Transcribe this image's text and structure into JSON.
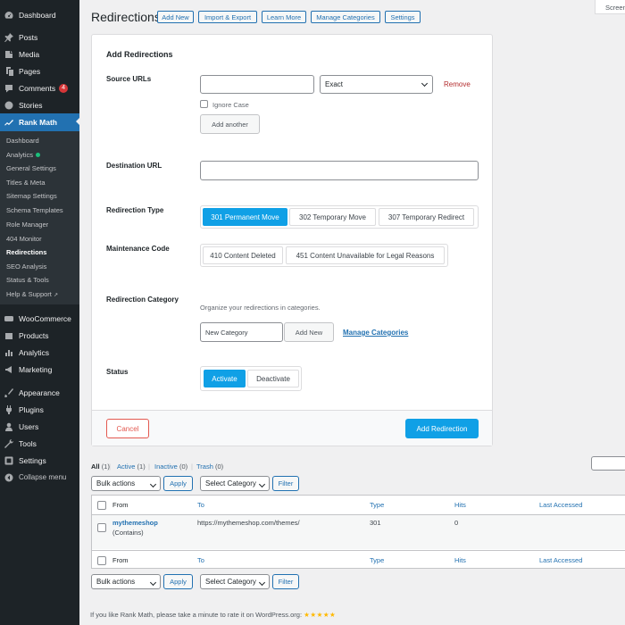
{
  "sidebar": {
    "top_items": [
      {
        "label": "Dashboard",
        "icon": "dashboard-icon"
      },
      {
        "label": "Posts",
        "icon": "pin-icon"
      },
      {
        "label": "Media",
        "icon": "media-icon"
      },
      {
        "label": "Pages",
        "icon": "pages-icon"
      },
      {
        "label": "Comments",
        "icon": "comment-icon",
        "badge": "4"
      },
      {
        "label": "Stories",
        "icon": "stories-icon"
      },
      {
        "label": "Rank Math",
        "icon": "rank-math-icon"
      }
    ],
    "submenu": [
      "Dashboard",
      "Analytics",
      "General Settings",
      "Titles & Meta",
      "Sitemap Settings",
      "Schema Templates",
      "Role Manager",
      "404 Monitor",
      "Redirections",
      "SEO Analysis",
      "Status & Tools",
      "Help & Support"
    ],
    "bottom_items": [
      {
        "label": "WooCommerce",
        "icon": "woocommerce-icon"
      },
      {
        "label": "Products",
        "icon": "products-icon"
      },
      {
        "label": "Analytics",
        "icon": "analytics-icon"
      },
      {
        "label": "Marketing",
        "icon": "marketing-icon"
      },
      {
        "label": "Appearance",
        "icon": "appearance-icon"
      },
      {
        "label": "Plugins",
        "icon": "plugins-icon"
      },
      {
        "label": "Users",
        "icon": "users-icon"
      },
      {
        "label": "Tools",
        "icon": "tools-icon"
      },
      {
        "label": "Settings",
        "icon": "settings-icon"
      },
      {
        "label": "Collapse menu",
        "icon": "collapse-icon"
      }
    ],
    "active_color": "#2271b1"
  },
  "header": {
    "title": "Redirections",
    "buttons": [
      "Add New",
      "Import & Export",
      "Learn More",
      "Manage Categories",
      "Settings"
    ],
    "screen_options": "Screen"
  },
  "form": {
    "heading": "Add Redirections",
    "source_label": "Source URLs",
    "source_value": "",
    "match_type": "Exact",
    "remove": "Remove",
    "ignore_case": "Ignore Case",
    "add_another": "Add another",
    "destination_label": "Destination URL",
    "destination_value": "",
    "type_label": "Redirection Type",
    "type_options": [
      "301 Permanent Move",
      "302 Temporary Move",
      "307 Temporary Redirect"
    ],
    "maintenance_label": "Maintenance Code",
    "maintenance_options": [
      "410 Content Deleted",
      "451 Content Unavailable for Legal Reasons"
    ],
    "category_label": "Redirection Category",
    "category_help": "Organize your redirections in categories.",
    "category_placeholder": "New Category",
    "category_add": "Add New",
    "manage_categories": "Manage Categories",
    "status_label": "Status",
    "status_options": [
      "Activate",
      "Deactivate"
    ],
    "cancel": "Cancel",
    "submit": "Add Redirection",
    "accent_color": "#10a0e6"
  },
  "list": {
    "filters": {
      "all": "All",
      "all_count": "(1)",
      "active": "Active",
      "active_count": "(1)",
      "inactive": "Inactive",
      "inactive_count": "(0)",
      "trash": "Trash",
      "trash_count": "(0)",
      "sep": "|"
    },
    "bulk_actions": "Bulk actions",
    "apply": "Apply",
    "select_category": "Select Category",
    "filter": "Filter",
    "columns": [
      "From",
      "To",
      "Type",
      "Hits",
      "Last Accessed"
    ],
    "rows": [
      {
        "from": "mythemeshop",
        "match": "(Contains)",
        "to": "https://mythemeshop.com/themes/",
        "type": "301",
        "hits": "0",
        "last": ""
      }
    ]
  },
  "footer": {
    "text": "If you like Rank Math, please take a minute to rate it on WordPress.org:",
    "stars": "★★★★★"
  }
}
